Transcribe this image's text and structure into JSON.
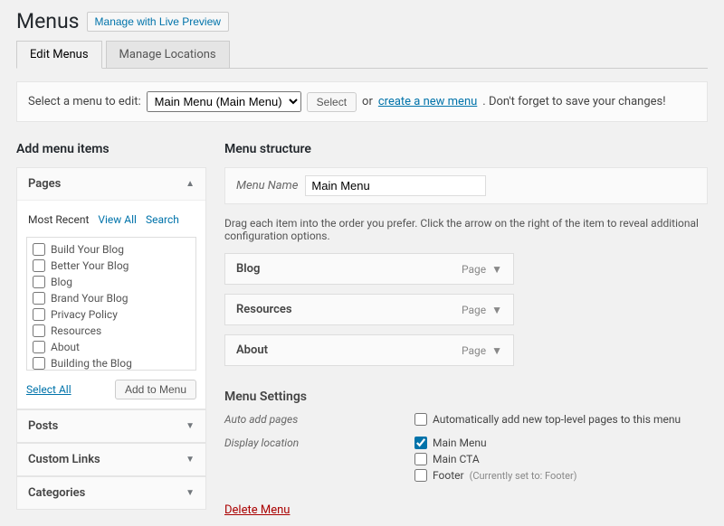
{
  "header": {
    "title": "Menus",
    "preview_button": "Manage with Live Preview"
  },
  "tabs": {
    "edit": "Edit Menus",
    "locations": "Manage Locations"
  },
  "select_bar": {
    "label": "Select a menu to edit:",
    "selected": "Main Menu (Main Menu)",
    "select_btn": "Select",
    "or": "or",
    "create_link": "create a new menu",
    "hint": ". Don't forget to save your changes!"
  },
  "left": {
    "heading": "Add menu items",
    "pages": {
      "title": "Pages",
      "subtabs": {
        "recent": "Most Recent",
        "all": "View All",
        "search": "Search"
      },
      "items": [
        "Build Your Blog",
        "Better Your Blog",
        "Blog",
        "Brand Your Blog",
        "Privacy Policy",
        "Resources",
        "About",
        "Building the Blog"
      ],
      "select_all": "Select All",
      "add_btn": "Add to Menu"
    },
    "posts": "Posts",
    "custom_links": "Custom Links",
    "categories": "Categories"
  },
  "right": {
    "heading": "Menu structure",
    "name_label": "Menu Name",
    "name_value": "Main Menu",
    "instructions": "Drag each item into the order you prefer. Click the arrow on the right of the item to reveal additional configuration options.",
    "items": [
      {
        "title": "Blog",
        "type": "Page"
      },
      {
        "title": "Resources",
        "type": "Page"
      },
      {
        "title": "About",
        "type": "Page"
      }
    ],
    "settings": {
      "heading": "Menu Settings",
      "auto_label": "Auto add pages",
      "auto_text": "Automatically add new top-level pages to this menu",
      "loc_label": "Display location",
      "locations": [
        {
          "label": "Main Menu",
          "checked": true,
          "hint": ""
        },
        {
          "label": "Main CTA",
          "checked": false,
          "hint": ""
        },
        {
          "label": "Footer",
          "checked": false,
          "hint": "(Currently set to: Footer)"
        }
      ]
    },
    "delete": "Delete Menu"
  }
}
